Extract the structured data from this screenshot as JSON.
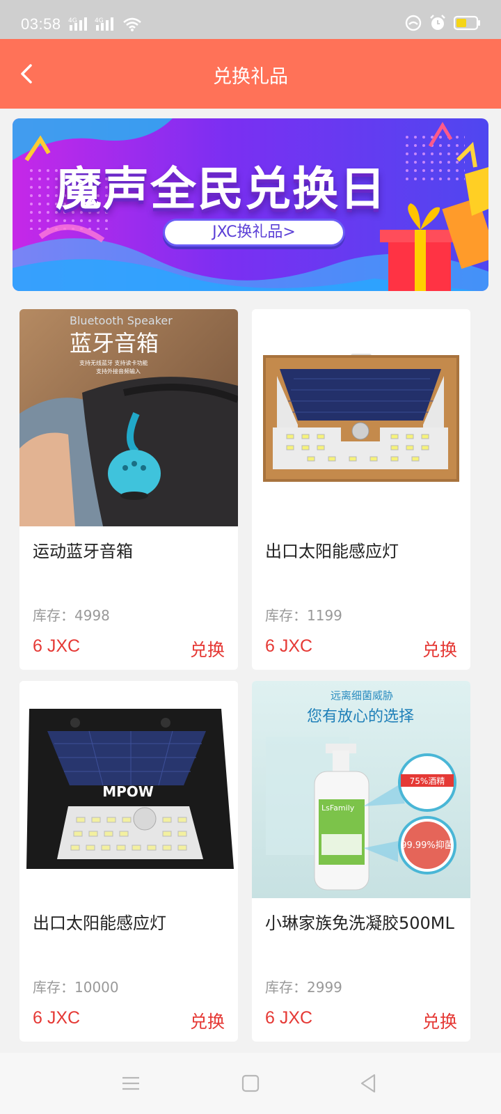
{
  "status": {
    "time": "03:58",
    "signal1": "4G",
    "signal2": "4G"
  },
  "header": {
    "title": "兑换礼品"
  },
  "banner": {
    "title": "魔声全民兑换日",
    "button": "JXC换礼品>",
    "image_caption": "Bluetooth Speaker"
  },
  "products": [
    {
      "name": "运动蓝牙音箱",
      "stock": "库存：4998",
      "price": "6 JXC",
      "action": "兑换",
      "image_text": {
        "en": "Bluetooth Speaker",
        "cn": "蓝牙音箱",
        "line1": "支持无线蓝牙 支持读卡功能",
        "line2": "支持外接音频输入"
      }
    },
    {
      "name": "出口太阳能感应灯",
      "stock": "库存：1199",
      "price": "6 JXC",
      "action": "兑换"
    },
    {
      "name": "出口太阳能感应灯",
      "stock": "库存：10000",
      "price": "6 JXC",
      "action": "兑换",
      "image_text": {
        "brand": "MPOW"
      }
    },
    {
      "name": "小琳家族免洗凝胶500ML",
      "stock": "库存：2999",
      "price": "6 JXC",
      "action": "兑换",
      "image_text": {
        "top": "远离细菌威胁",
        "headline": "您有放心的选择",
        "badge1": "75%酒精",
        "badge2": "99.99%抑菌",
        "bottle": "LsFamily"
      }
    }
  ],
  "colors": {
    "primary": "#ff7258",
    "price": "#e53935",
    "background": "#f2f2f2"
  }
}
